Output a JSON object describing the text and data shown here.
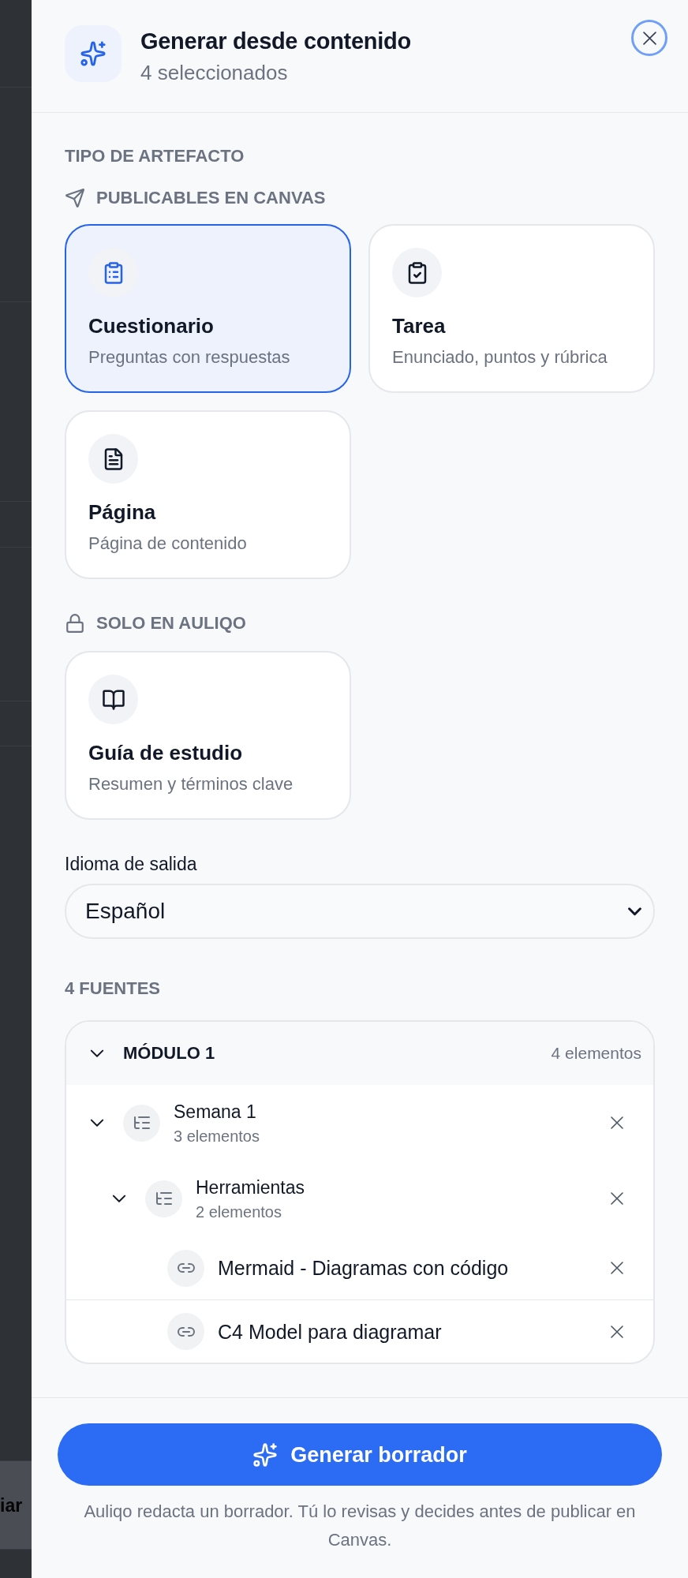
{
  "backdrop": {
    "text": "iar"
  },
  "header": {
    "title": "Generar desde contenido",
    "subtitle": "4 seleccionados"
  },
  "close_button": {
    "focused": true
  },
  "artifact_type": {
    "heading": "TIPO DE ARTEFACTO",
    "groups": [
      {
        "kind": "publish",
        "label": "PUBLICABLES EN CANVAS",
        "cards": [
          {
            "kind": "quiz",
            "title": "Cuestionario",
            "description": "Preguntas con respuestas",
            "selected": true
          },
          {
            "kind": "assignment",
            "title": "Tarea",
            "description": "Enunciado, puntos y rúbrica",
            "selected": false
          },
          {
            "kind": "page",
            "title": "Página",
            "description": "Página de contenido",
            "selected": false
          }
        ]
      },
      {
        "kind": "local",
        "label": "SOLO EN AULIQO",
        "cards": [
          {
            "kind": "study_guide",
            "title": "Guía de estudio",
            "description": "Resumen y términos clave",
            "selected": false
          }
        ]
      }
    ]
  },
  "output_language": {
    "label": "Idioma de salida",
    "value": "Español"
  },
  "sources": {
    "heading": "4 FUENTES",
    "module": {
      "title": "MÓDULO 1",
      "count": "4 elementos",
      "expanded": true,
      "children": [
        {
          "kind": "folder",
          "title": "Semana 1",
          "count": "3 elementos",
          "expanded": true,
          "children": [
            {
              "kind": "folder",
              "title": "Herramientas",
              "count": "2 elementos",
              "expanded": true,
              "children": [
                {
                  "kind": "link",
                  "title": "Mermaid - Diagramas con código"
                },
                {
                  "kind": "link",
                  "title": "C4 Model para diagramar"
                }
              ]
            }
          ]
        }
      ]
    }
  },
  "footer": {
    "button": "Generar borrador",
    "note": "Auliqo redacta un borrador. Tú lo revisas y decides antes de publicar en Canvas."
  }
}
